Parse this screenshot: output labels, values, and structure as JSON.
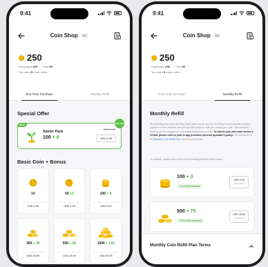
{
  "status": {
    "time": "9:41"
  },
  "nav": {
    "title": "Coin Shop",
    "lang_badge": "EN"
  },
  "balance": {
    "amount": "250",
    "purchased_label": "Purchased",
    "purchased_value": "200",
    "free_label": "Free",
    "free_value": "50",
    "need_prefix": "You need",
    "need_count": "5",
    "need_suffix": "more coins"
  },
  "tabs": [
    {
      "label": "One-Time Purchase"
    },
    {
      "label": "Monthly Refill"
    }
  ],
  "special_offer": {
    "section_title": "Special Offer",
    "tag": "BEST",
    "discount_badge": "50% OFF",
    "name": "Starter Pack",
    "amount": "100",
    "bonus": "+ 8",
    "old_price": "USD 9.99",
    "price": "USD 5.99"
  },
  "basic": {
    "section_title": "Basic Coin + Bonus",
    "packs": [
      {
        "amount": "10",
        "bonus": "",
        "price": "USD 0.99",
        "icon": "single-coin-icon"
      },
      {
        "amount": "50",
        "bonus": "+2",
        "price": "USD 4.99",
        "icon": "single-coin-icon"
      },
      {
        "amount": "100",
        "bonus": "+ 8",
        "price": "USD 9.99",
        "icon": "coin-stack-icon"
      },
      {
        "amount": "300",
        "bonus": "+ 30",
        "price": "USD 29.99",
        "icon": "coin-pile-icon"
      },
      {
        "amount": "500",
        "bonus": "+ 60",
        "price": "USD 49.99",
        "icon": "coin-pile-icon"
      },
      {
        "amount": "1000",
        "bonus": "+ 150",
        "price": "USD 99.99",
        "icon": "coin-heap-icon"
      }
    ]
  },
  "refill": {
    "section_title": "Monthly Refill",
    "desc_part1": "By selecting any of the Monthly Refill plans below, you are enrolling in an automatic monthly payment of the selected amount that will continue until you cancel your plan. The selected amount will be charged on a recurring basis every month.",
    "desc_bold": "To cancel your plan and receive a refund, please refer to your in-app purchase account operator's policy.",
    "desc_part2": "The full terms of the",
    "desc_link": "Monthly Coin Refill Plan",
    "desc_part3": "can be found below.",
    "intro": "To activate, please select one of the following Monthly Refill plans:",
    "plans": [
      {
        "amount": "100",
        "bonus": "+ 3",
        "first_bonus": "+ 5 on first purchase",
        "price": "USD 9.99",
        "per": "per month"
      },
      {
        "amount": "500",
        "bonus": "+ 75",
        "first_bonus": "+ 25 on first purchase",
        "price": "USD 49.99",
        "per": "per month"
      }
    ],
    "terms_label": "Monthly Coin Refill Plan Terms"
  },
  "colors": {
    "coin": "#f2b705",
    "green": "#5cc04a",
    "bonus_green": "#4caf3c",
    "link": "#3a7bd5"
  }
}
